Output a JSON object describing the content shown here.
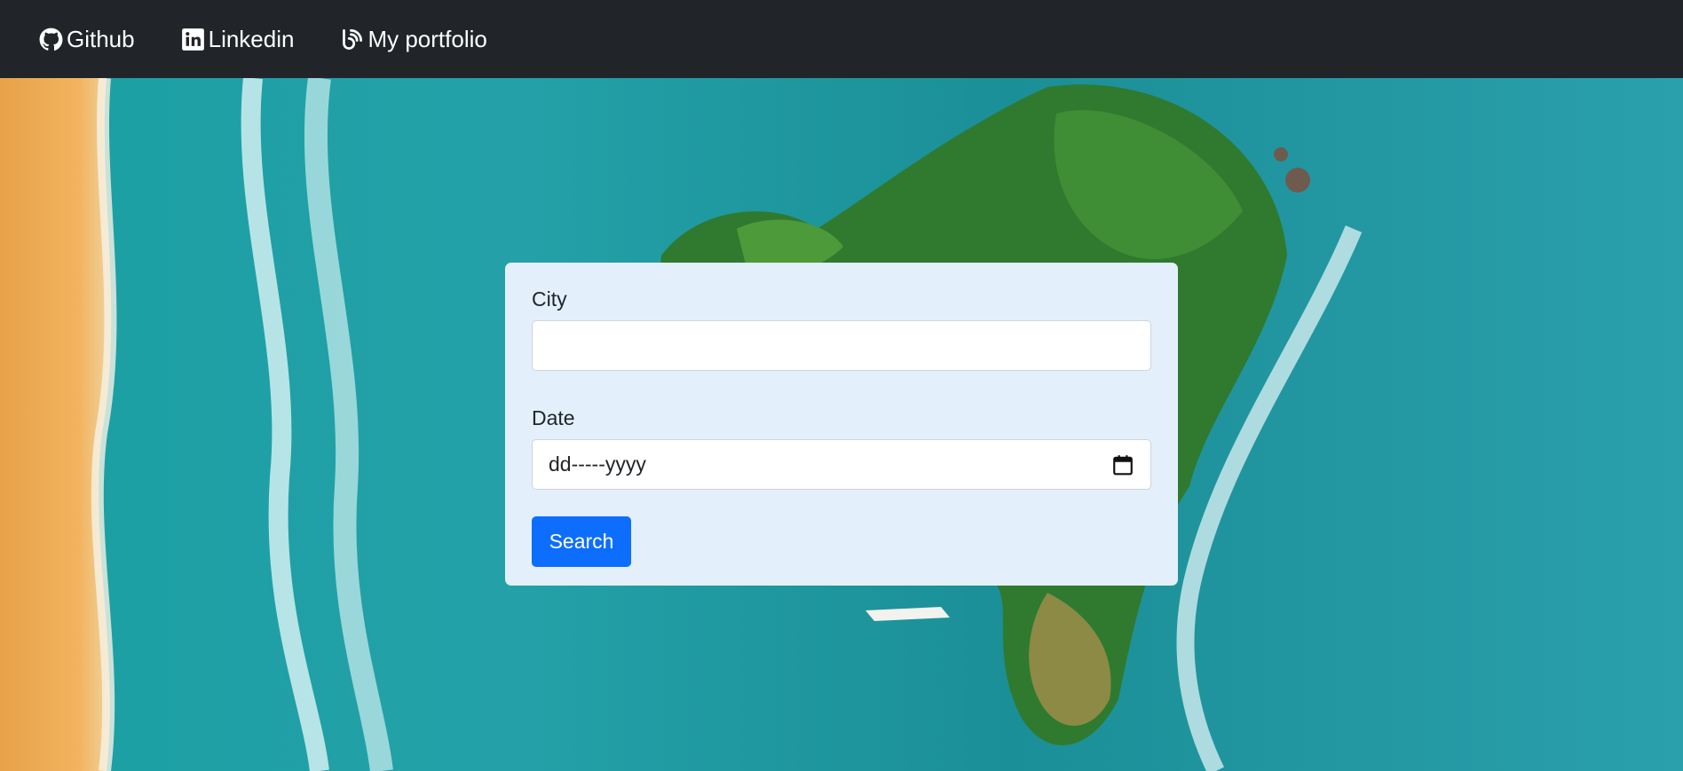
{
  "navbar": {
    "links": [
      {
        "label": "Github",
        "icon": "github-icon"
      },
      {
        "label": "Linkedin",
        "icon": "linkedin-icon"
      },
      {
        "label": "My portfolio",
        "icon": "blog-icon"
      }
    ]
  },
  "form": {
    "city_label": "City",
    "city_value": "",
    "date_label": "Date",
    "date_value": "dd-----yyyy",
    "search_label": "Search"
  },
  "colors": {
    "navbar_bg": "#212529",
    "card_bg": "#e3f0fc",
    "button_bg": "#0d6efd"
  }
}
